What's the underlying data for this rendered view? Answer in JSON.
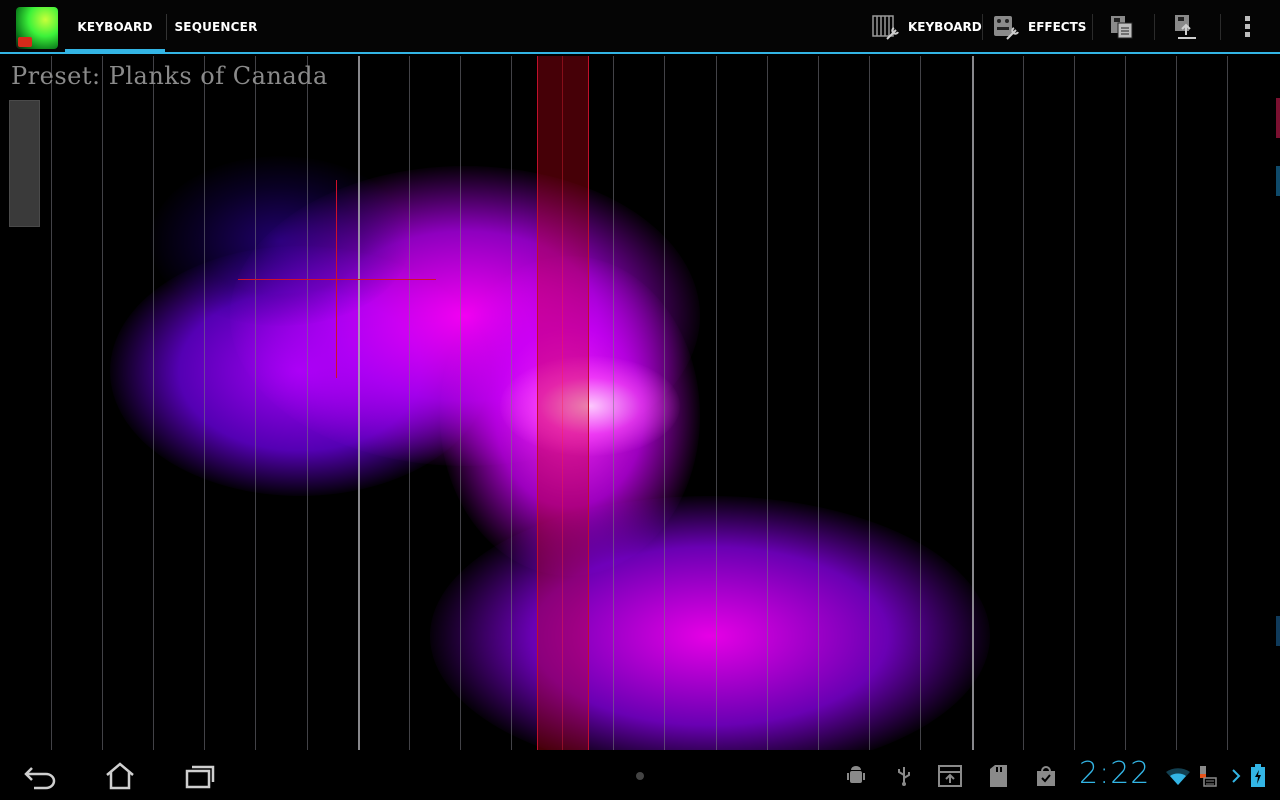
{
  "action_bar": {
    "app_icon": "app-logo",
    "tabs": [
      {
        "label": "KEYBOARD",
        "selected": true
      },
      {
        "label": "SEQUENCER",
        "selected": false
      }
    ],
    "actions": {
      "keyboard_label": "KEYBOARD",
      "effects_label": "EFFECTS",
      "save_icon": "save-preset-icon",
      "load_icon": "load-preset-icon",
      "overflow_icon": "overflow-menu-icon"
    },
    "accent_color": "#33b5e5"
  },
  "canvas": {
    "preset_label": "Preset: Planks of Canada",
    "highlight_color": "#d0102a",
    "glow_colors": [
      "#ff00ff",
      "#8800ff",
      "#ff33cc"
    ]
  },
  "system_bar": {
    "nav": [
      "back-icon",
      "home-icon",
      "recent-apps-icon"
    ],
    "notifications": [
      "android-debug-icon",
      "usb-icon",
      "download-icon",
      "sd-card-icon",
      "shopping-bag-icon"
    ],
    "time": "2:22",
    "status_icons": [
      "wifi-icon",
      "keyboard-icon",
      "battery-icon"
    ]
  }
}
